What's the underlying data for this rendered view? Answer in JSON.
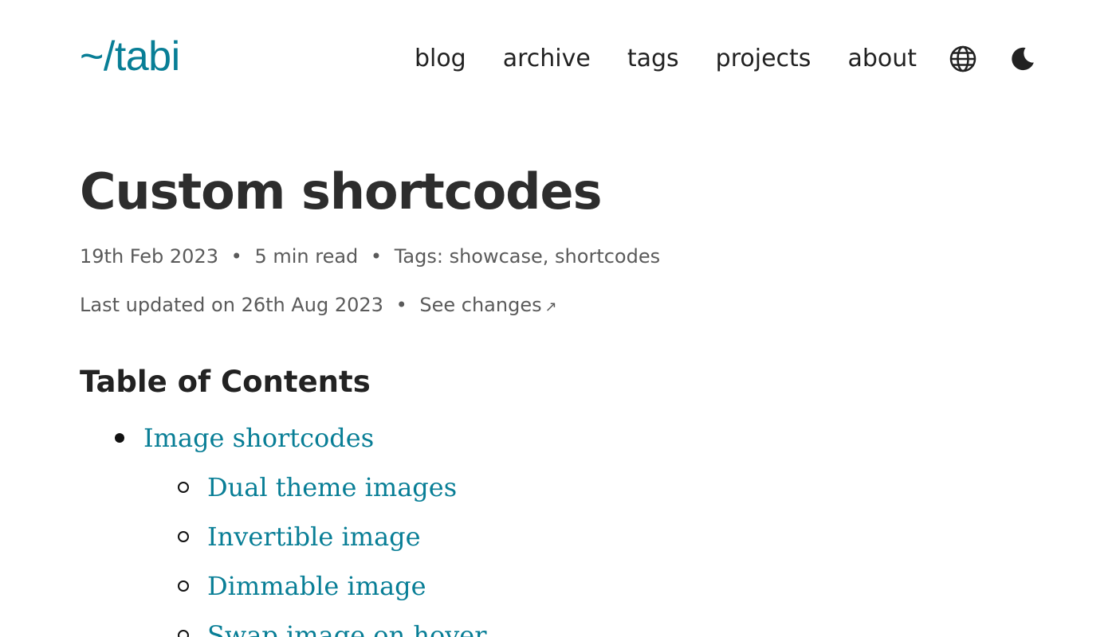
{
  "header": {
    "logo": "~/tabi",
    "nav": [
      "blog",
      "archive",
      "tags",
      "projects",
      "about"
    ],
    "icons": [
      "globe-icon",
      "moon-icon"
    ]
  },
  "post": {
    "title": "Custom shortcodes",
    "date": "19th Feb 2023",
    "read_time": "5 min read",
    "tags_label": "Tags:",
    "tags": [
      "showcase",
      "shortcodes"
    ],
    "updated": "Last updated on 26th Aug 2023",
    "changes_link": "See changes",
    "changes_arrow": "↗"
  },
  "toc": {
    "heading": "Table of Contents",
    "items": [
      {
        "label": "Image shortcodes",
        "level": 1
      },
      {
        "label": "Dual theme images",
        "level": 2
      },
      {
        "label": "Invertible image",
        "level": 2
      },
      {
        "label": "Dimmable image",
        "level": 2
      },
      {
        "label": "Swap image on hover",
        "level": 2
      }
    ]
  },
  "colors": {
    "accent": "#087e96",
    "text": "#222222",
    "meta": "#5a5a5a"
  }
}
